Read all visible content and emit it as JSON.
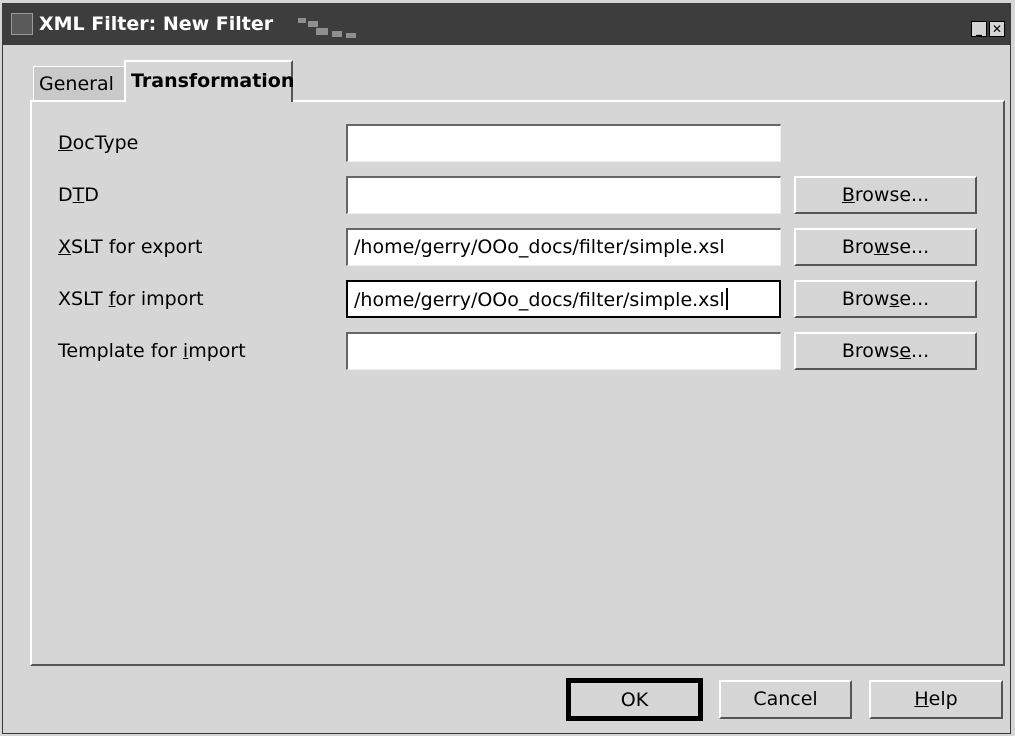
{
  "window": {
    "title": "XML Filter: New Filter",
    "controls": {
      "minimize_icon": "_",
      "close_icon": "✕"
    }
  },
  "tabs": [
    {
      "label": "General",
      "active": false
    },
    {
      "label": "Transformation",
      "active": true
    }
  ],
  "form": {
    "doctype": {
      "label": "DocType",
      "mnemonic": "D",
      "value": ""
    },
    "dtd": {
      "label": "DTD",
      "mnemonic": "T",
      "value": "",
      "browse": "Browse..."
    },
    "xslt_export": {
      "label": "XSLT for export",
      "mnemonic": "X",
      "value": "/home/gerry/OOo_docs/filter/simple.xsl",
      "browse": "Browse..."
    },
    "xslt_import": {
      "label": "XSLT for import",
      "mnemonic": "f",
      "value": "/home/gerry/OOo_docs/filter/simple.xsl",
      "browse": "Browse..."
    },
    "template_import": {
      "label": "Template for import",
      "mnemonic": "i",
      "value": "",
      "browse": "Browse..."
    }
  },
  "buttons": {
    "ok": "OK",
    "cancel": "Cancel",
    "help": "Help"
  }
}
